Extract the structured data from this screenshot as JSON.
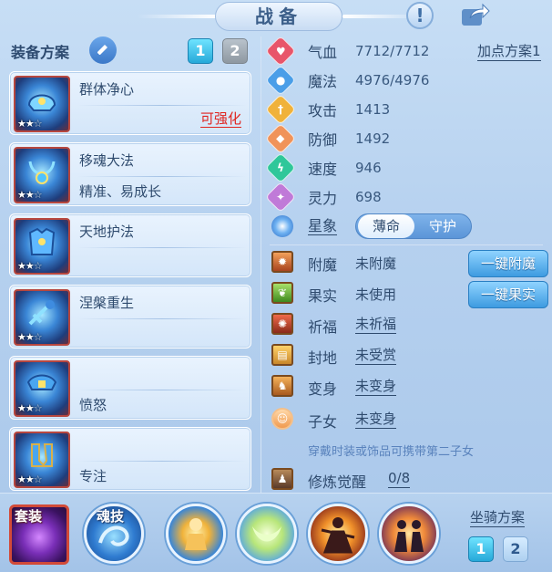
{
  "header": {
    "title": "战备"
  },
  "equipment": {
    "header_label": "装备方案",
    "plans": [
      "1",
      "2"
    ],
    "active_plan": "1",
    "items": [
      {
        "name": "群体净心",
        "sub": "",
        "status": "可强化",
        "stars_filled": 2,
        "stars_total": 3
      },
      {
        "name": "移魂大法",
        "sub": "精准、易成长",
        "status": "",
        "stars_filled": 2,
        "stars_total": 3
      },
      {
        "name": "天地护法",
        "sub": "",
        "status": "",
        "stars_filled": 2,
        "stars_total": 3
      },
      {
        "name": "涅槃重生",
        "sub": "",
        "status": "",
        "stars_filled": 2,
        "stars_total": 3
      },
      {
        "name": "",
        "sub": "愤怒",
        "status": "",
        "stars_filled": 2,
        "stars_total": 3
      },
      {
        "name": "",
        "sub": "专注",
        "status": "",
        "stars_filled": 2,
        "stars_total": 3
      }
    ]
  },
  "stats": {
    "add_point_plan": "加点方案1",
    "rows": [
      {
        "label": "气血",
        "value": "7712/7712",
        "color": "#e8556a",
        "icon": "heart-icon"
      },
      {
        "label": "魔法",
        "value": "4976/4976",
        "color": "#4a9ee8",
        "icon": "drop-icon"
      },
      {
        "label": "攻击",
        "value": "1413",
        "color": "#f0b23a",
        "icon": "sword-icon"
      },
      {
        "label": "防御",
        "value": "1492",
        "color": "#f0935a",
        "icon": "shield-icon"
      },
      {
        "label": "速度",
        "value": "946",
        "color": "#2fc79a",
        "icon": "lightning-icon"
      },
      {
        "label": "灵力",
        "value": "698",
        "color": "#c07ad8",
        "icon": "sparkle-icon"
      }
    ]
  },
  "constellation": {
    "label": "星象",
    "options": [
      "薄命",
      "守护"
    ],
    "selected": "薄命"
  },
  "attributes": {
    "rows": [
      {
        "label": "附魔",
        "value": "未附魔",
        "underline": false,
        "color": "#c0502a"
      },
      {
        "label": "果实",
        "value": "未使用",
        "underline": false,
        "color": "#5a9a2a"
      },
      {
        "label": "祈福",
        "value": "未祈福",
        "underline": true,
        "color": "#c8402a"
      },
      {
        "label": "封地",
        "value": "未受赏",
        "underline": true,
        "color": "#d8902a"
      },
      {
        "label": "变身",
        "value": "未变身",
        "underline": true,
        "color": "#d07a2a"
      },
      {
        "label": "子女",
        "value": "未变身",
        "underline": true,
        "color": "#f0a060"
      }
    ],
    "enchant_button": "一键附魔",
    "fruit_button": "一键果实"
  },
  "hint": "穿戴时装或饰品可携带第二子女",
  "cultivation": {
    "label": "修炼觉醒",
    "value": "0/8"
  },
  "bottom": {
    "set_label": "套装",
    "soul_label": "魂技",
    "mount_label": "坐骑方案",
    "mount_plans": [
      "1",
      "2"
    ]
  }
}
